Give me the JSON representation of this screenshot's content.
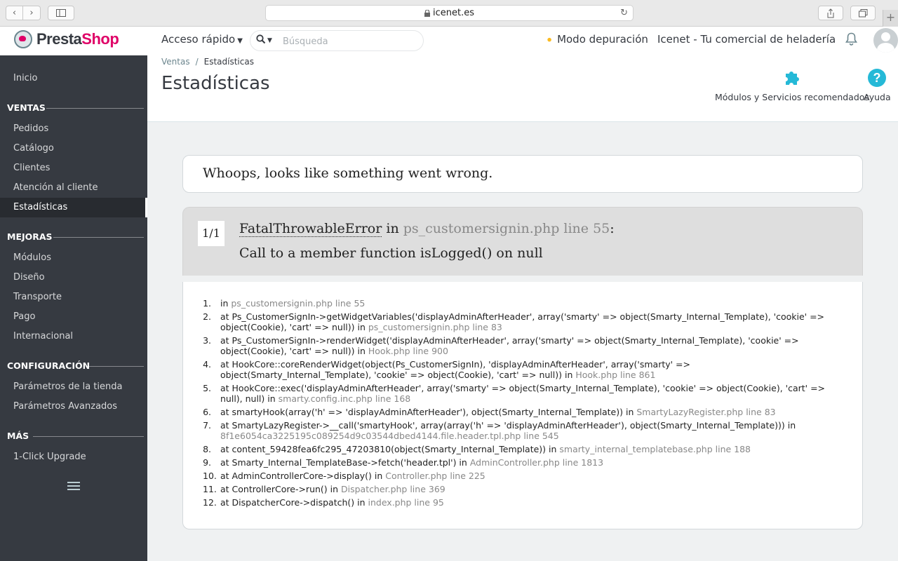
{
  "browser": {
    "url": "icenet.es",
    "icons": {
      "back": "chevron-left-icon",
      "forward": "chevron-right-icon",
      "sidebar": "sidebar-icon",
      "lock": "lock-icon",
      "reload": "reload-icon",
      "share": "share-icon",
      "tabs": "tabs-icon",
      "newtab": "plus-icon"
    }
  },
  "header": {
    "logo_prefix": "Presta",
    "logo_suffix": "Shop",
    "quick_access": "Acceso rápido",
    "search_placeholder": "Búsqueda",
    "debug_mode": "Modo depuración",
    "shop_name": "Icenet - Tu comercial de heladería",
    "colors": {
      "brand": "#df0067",
      "accent": "#25b9d7",
      "debug": "#fbbb22"
    }
  },
  "sidebar": {
    "home": "Inicio",
    "sections": [
      {
        "title": "VENTAS",
        "items": [
          "Pedidos",
          "Catálogo",
          "Clientes",
          "Atención al cliente",
          "Estadísticas"
        ]
      },
      {
        "title": "MEJORAS",
        "items": [
          "Módulos",
          "Diseño",
          "Transporte",
          "Pago",
          "Internacional"
        ]
      },
      {
        "title": "CONFIGURACIÓN",
        "items": [
          "Parámetros de la tienda",
          "Parámetros Avanzados"
        ]
      },
      {
        "title": "MÁS",
        "items": [
          "1-Click Upgrade"
        ]
      }
    ],
    "active_item": "Estadísticas"
  },
  "page": {
    "breadcrumb": [
      "Ventas",
      "Estadísticas"
    ],
    "title": "Estadísticas",
    "toolbar": {
      "modules": "Módulos y Servicios recomendados",
      "help": "Ayuda"
    }
  },
  "error": {
    "whoops": "Whoops, looks like something went wrong.",
    "count": "1/1",
    "class": "FatalThrowableError",
    "in_word": "in",
    "file_ref": "ps_customersignin.php line 55",
    "colon": ":",
    "message": "Call to a member function isLogged() on null",
    "trace": [
      {
        "n": "1.",
        "text": "in ",
        "loc": "ps_customersignin.php line 55"
      },
      {
        "n": "2.",
        "text": "at Ps_CustomerSignIn->getWidgetVariables('displayAdminAfterHeader', array('smarty' => object(Smarty_Internal_Template), 'cookie' => object(Cookie), 'cart' => null)) in ",
        "loc": "ps_customersignin.php line 83"
      },
      {
        "n": "3.",
        "text": "at Ps_CustomerSignIn->renderWidget('displayAdminAfterHeader', array('smarty' => object(Smarty_Internal_Template), 'cookie' => object(Cookie), 'cart' => null)) in ",
        "loc": "Hook.php line 900"
      },
      {
        "n": "4.",
        "text": "at HookCore::coreRenderWidget(object(Ps_CustomerSignIn), 'displayAdminAfterHeader', array('smarty' => object(Smarty_Internal_Template), 'cookie' => object(Cookie), 'cart' => null)) in ",
        "loc": "Hook.php line 861"
      },
      {
        "n": "5.",
        "text": "at HookCore::exec('displayAdminAfterHeader', array('smarty' => object(Smarty_Internal_Template), 'cookie' => object(Cookie), 'cart' => null), null) in ",
        "loc": "smarty.config.inc.php line 168"
      },
      {
        "n": "6.",
        "text": "at smartyHook(array('h' => 'displayAdminAfterHeader'), object(Smarty_Internal_Template)) in ",
        "loc": "SmartyLazyRegister.php line 83"
      },
      {
        "n": "7.",
        "text": "at SmartyLazyRegister->__call('smartyHook', array(array('h' => 'displayAdminAfterHeader'), object(Smarty_Internal_Template))) in ",
        "loc": "8f1e6054ca3225195c089254d9c03544dbed4144.file.header.tpl.php line 545"
      },
      {
        "n": "8.",
        "text": "at content_59428fea6fc295_47203810(object(Smarty_Internal_Template)) in ",
        "loc": "smarty_internal_templatebase.php line 188"
      },
      {
        "n": "9.",
        "text": "at Smarty_Internal_TemplateBase->fetch('header.tpl') in ",
        "loc": "AdminController.php line 1813"
      },
      {
        "n": "10.",
        "text": "at AdminControllerCore->display() in ",
        "loc": "Controller.php line 225"
      },
      {
        "n": "11.",
        "text": "at ControllerCore->run() in ",
        "loc": "Dispatcher.php line 369"
      },
      {
        "n": "12.",
        "text": "at DispatcherCore->dispatch() in ",
        "loc": "index.php line 95"
      }
    ]
  }
}
